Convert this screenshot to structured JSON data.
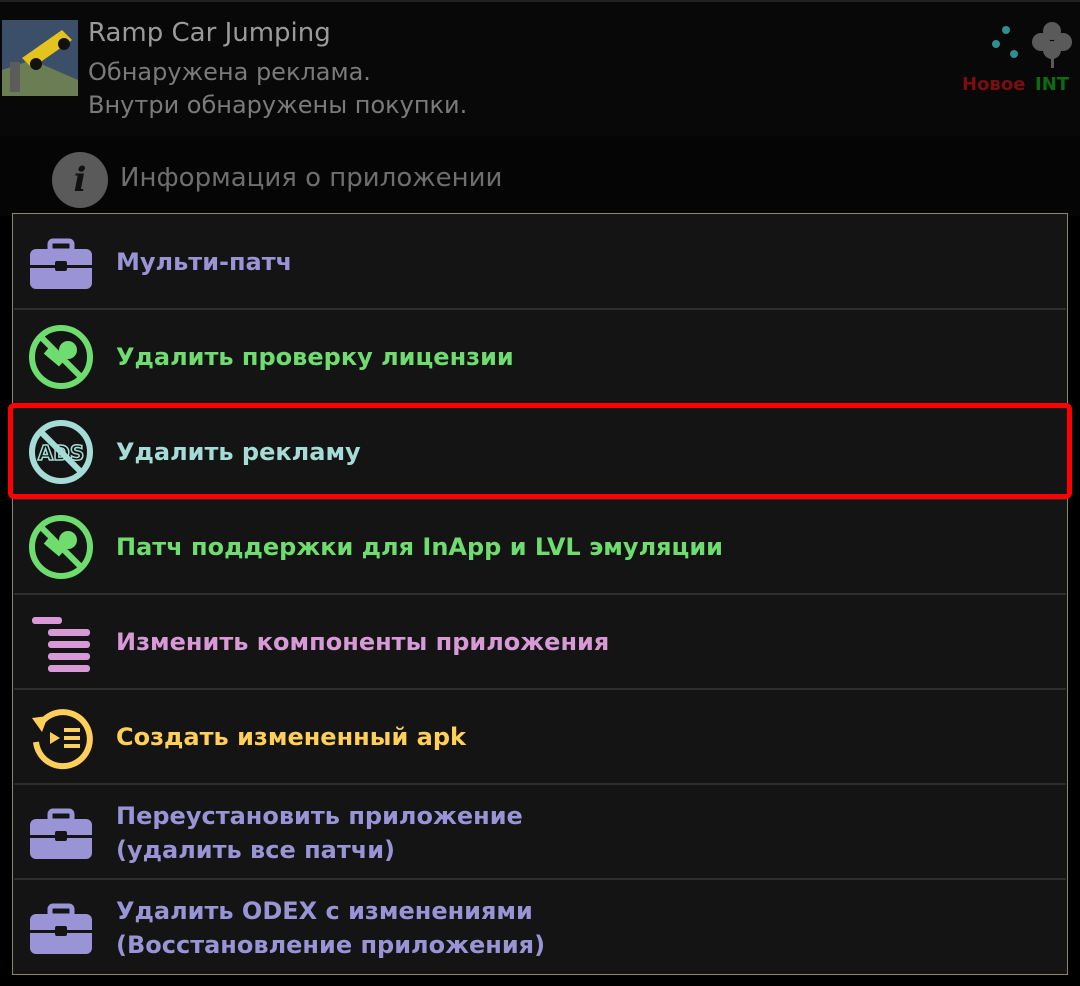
{
  "app": {
    "name": "Ramp Car Jumping",
    "status_line1": "Обнаружена реклама.",
    "status_line2": "Внутри обнаружены покупки.",
    "badge_new": "Новое",
    "badge_int": "INT",
    "icons": [
      "app-thumbnail",
      "dots-icon",
      "clover-icon"
    ]
  },
  "info_row": {
    "label": "Информация о приложении",
    "icon": "info-icon"
  },
  "menu": {
    "items": [
      {
        "label": "Мульти-патч",
        "icon": "toolbox-icon",
        "color": "#9a94d6"
      },
      {
        "label": "Удалить проверку лицензии",
        "icon": "no-key-icon",
        "color": "#6fdc6f"
      },
      {
        "label": "Удалить рекламу",
        "icon": "no-ads-icon",
        "color": "#a6dcd6",
        "selected": true
      },
      {
        "label": "Патч поддержки для InApp и LVL эмуляции",
        "icon": "no-key-icon",
        "color": "#6fdc6f"
      },
      {
        "label": "Изменить компоненты приложения",
        "icon": "components-list-icon",
        "color": "#d79ad6"
      },
      {
        "label": "Создать измененный apk",
        "icon": "rebuild-icon",
        "color": "#ffcf5a"
      },
      {
        "label_line1": "Переустановить приложение",
        "label_line2": "(удалить все патчи)",
        "icon": "toolbox-icon",
        "color": "#9a94d6"
      },
      {
        "label_line1": "Удалить ODEX с изменениями",
        "label_line2": "(Восстановление приложения)",
        "icon": "toolbox-icon",
        "color": "#9a94d6"
      }
    ]
  },
  "colors": {
    "highlight": "#ff0000",
    "background": "#000000",
    "dialog_bg": "#141414"
  }
}
